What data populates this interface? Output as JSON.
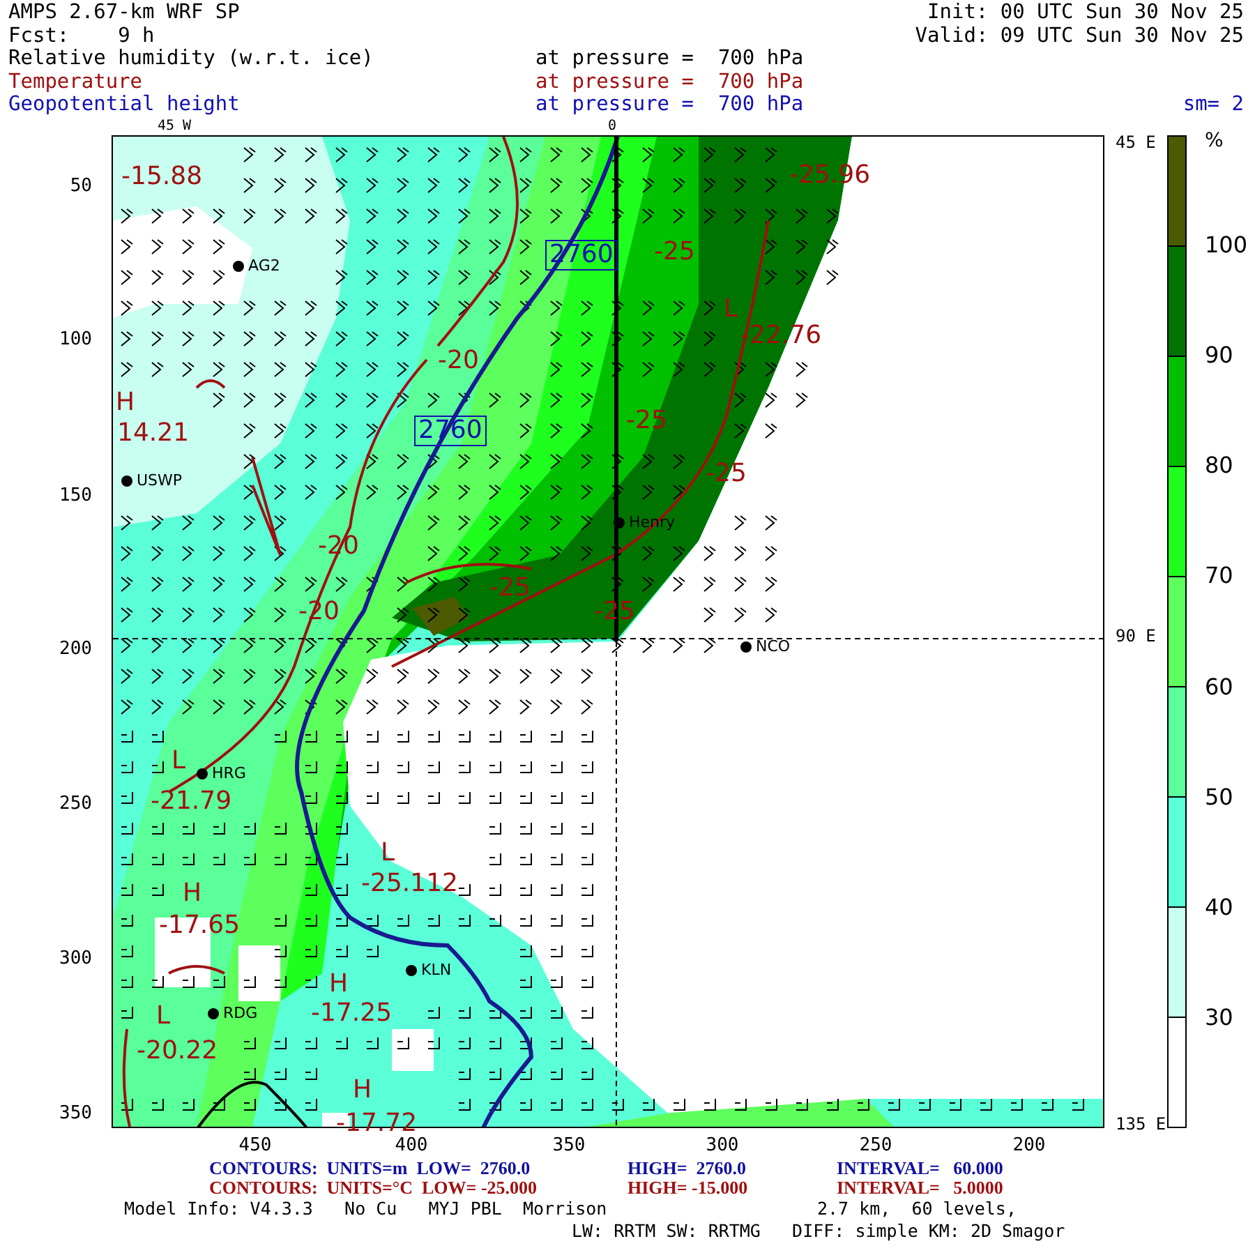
{
  "header": {
    "title": "AMPS 2.67-km WRF SP",
    "init": "Init: 00 UTC Sun 30 Nov 25",
    "forecast": "Fcst:    9 h",
    "valid": "Valid: 09 UTC Sun 30 Nov 25",
    "fields": [
      {
        "kind": "shaded",
        "name": "Relative humidity (w.r.t. ice)",
        "level": "at pressure =  700 hPa"
      },
      {
        "kind": "temperature",
        "name": "Temperature",
        "level": "at pressure =  700 hPa"
      },
      {
        "kind": "height",
        "name": "Geopotential height",
        "level": "at pressure =  700 hPa"
      }
    ],
    "smoothing": "sm= 2"
  },
  "map": {
    "top_labels": [
      "45 W",
      "0"
    ],
    "y_ticks": [
      "50",
      "100",
      "150",
      "200",
      "250",
      "300",
      "350"
    ],
    "x_ticks": [
      "450",
      "400",
      "350",
      "300",
      "250",
      "200"
    ],
    "right_labels": [
      "45 E",
      "90 E",
      "135 E"
    ],
    "labels": [
      {
        "kind": "temperature",
        "text": "-15.88"
      },
      {
        "kind": "station",
        "text": "AG2"
      },
      {
        "kind": "height",
        "text": "2760"
      },
      {
        "kind": "temperature",
        "text": "-25"
      },
      {
        "kind": "temperature",
        "text": "-25.96"
      },
      {
        "kind": "center",
        "text": "L"
      },
      {
        "kind": "temperature",
        "text": "-22.76"
      },
      {
        "kind": "temperature",
        "text": "-20"
      },
      {
        "kind": "center",
        "text": "H"
      },
      {
        "kind": "temperature",
        "text": "14.21"
      },
      {
        "kind": "height",
        "text": "2760"
      },
      {
        "kind": "temperature",
        "text": "-25"
      },
      {
        "kind": "temperature",
        "text": "-25"
      },
      {
        "kind": "station",
        "text": "USWP"
      },
      {
        "kind": "station",
        "text": "Henry"
      },
      {
        "kind": "temperature",
        "text": "-20"
      },
      {
        "kind": "temperature",
        "text": "-25"
      },
      {
        "kind": "temperature",
        "text": "-25"
      },
      {
        "kind": "temperature",
        "text": "-20"
      },
      {
        "kind": "station",
        "text": "NCO"
      },
      {
        "kind": "center",
        "text": "L"
      },
      {
        "kind": "station",
        "text": "HRG"
      },
      {
        "kind": "temperature",
        "text": "-21.79"
      },
      {
        "kind": "center",
        "text": "L"
      },
      {
        "kind": "temperature",
        "text": "-25.112"
      },
      {
        "kind": "center",
        "text": "H"
      },
      {
        "kind": "temperature",
        "text": "-17.65"
      },
      {
        "kind": "station",
        "text": "KLN"
      },
      {
        "kind": "center",
        "text": "H"
      },
      {
        "kind": "center",
        "text": "L"
      },
      {
        "kind": "station",
        "text": "RDG"
      },
      {
        "kind": "temperature",
        "text": "-17.25"
      },
      {
        "kind": "temperature",
        "text": "-20.22"
      },
      {
        "kind": "center",
        "text": "H"
      },
      {
        "kind": "temperature",
        "text": "-17.72"
      }
    ]
  },
  "legend": {
    "unit": "%",
    "bins": [
      {
        "color": "#4c5a00"
      },
      {
        "color": "#007400",
        "label": "100"
      },
      {
        "color": "#00c000",
        "label": "90"
      },
      {
        "color": "#1eff1e",
        "label": "80"
      },
      {
        "color": "#5cff5c",
        "label": "70"
      },
      {
        "color": "#5aff9a",
        "label": "60"
      },
      {
        "color": "#5affd8",
        "label": "50"
      },
      {
        "color": "#c8fff0",
        "label": "40"
      },
      {
        "color": "#ffffff",
        "label": "30"
      }
    ]
  },
  "contour_info": [
    {
      "kind": "height",
      "parts": [
        "CONTOURS:  UNITS=m  LOW=  2760.0",
        "HIGH=  2760.0",
        "INTERVAL=   60.000"
      ]
    },
    {
      "kind": "temperature",
      "parts": [
        "CONTOURS:  UNITS=°C  LOW= -25.000",
        "HIGH= -15.000",
        "INTERVAL=   5.0000"
      ]
    }
  ],
  "model_info": {
    "line_1": "Model Info: V4.3.3   No Cu   MYJ PBL  Morrison",
    "resolution": "2.7 km,  60 levels,",
    "line_2": "LW: RRTM SW: RRTMG   DIFF: simple KM: 2D Smagor"
  }
}
